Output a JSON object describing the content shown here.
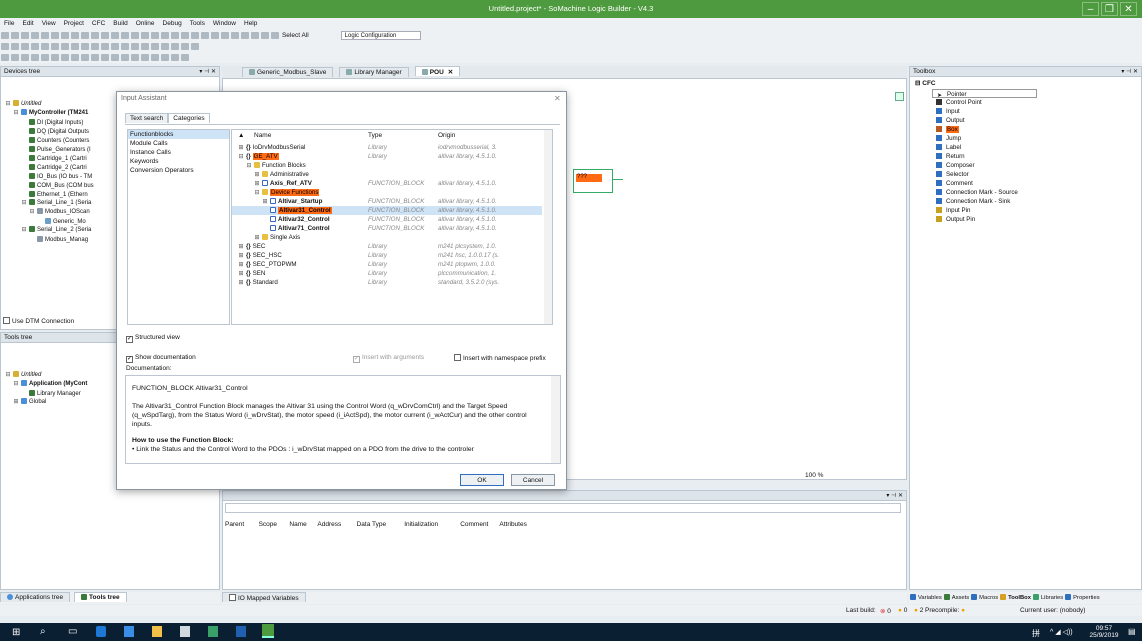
{
  "window": {
    "title": "Untitled.project* - SoMachine Logic Builder - V4.3"
  },
  "menu": [
    "File",
    "Edit",
    "View",
    "Project",
    "CFC",
    "Build",
    "Online",
    "Debug",
    "Tools",
    "Window",
    "Help"
  ],
  "toolbar": {
    "select_all": "Select All",
    "logic_config": "Logic Configuration"
  },
  "devices": {
    "title": "Devices tree",
    "items": [
      {
        "label": "Untitled",
        "level": 0,
        "exp": "-",
        "italic": true
      },
      {
        "label": "MyController (TM241",
        "level": 1,
        "exp": "-",
        "bold": true
      },
      {
        "label": "DI (Digital Inputs)",
        "level": 2
      },
      {
        "label": "DQ (Digital Outputs",
        "level": 2
      },
      {
        "label": "Counters (Counters",
        "level": 2
      },
      {
        "label": "Pulse_Generators (I",
        "level": 2
      },
      {
        "label": "Cartridge_1 (Cartri",
        "level": 2
      },
      {
        "label": "Cartridge_2 (Cartri",
        "level": 2
      },
      {
        "label": "IO_Bus (IO bus - TM",
        "level": 2
      },
      {
        "label": "COM_Bus (COM bus",
        "level": 2
      },
      {
        "label": "Ethernet_1 (Ethern",
        "level": 2
      },
      {
        "label": "Serial_Line_1 (Seria",
        "level": 2,
        "exp": "-"
      },
      {
        "label": "Modbus_IOScan",
        "level": 3,
        "exp": "-"
      },
      {
        "label": "Generic_Mo",
        "level": 4
      },
      {
        "label": "Serial_Line_2 (Seria",
        "level": 2,
        "exp": "-"
      },
      {
        "label": "Modbus_Manag",
        "level": 3
      }
    ],
    "use_dtm": "Use DTM Connection"
  },
  "tools_tree": {
    "title": "Tools tree",
    "items": [
      {
        "label": "Untitled",
        "level": 0,
        "exp": "-",
        "italic": true
      },
      {
        "label": "Application (MyCont",
        "level": 1,
        "exp": "-",
        "bold": true
      },
      {
        "label": "Library Manager",
        "level": 2
      },
      {
        "label": "Global",
        "level": 1,
        "exp": "+"
      }
    ]
  },
  "bottom_tabs": {
    "applications": "Applications tree",
    "tools": "Tools tree",
    "io_mapped": "IO Mapped Variables"
  },
  "doc_tabs": [
    "Generic_Modbus_Slave",
    "Library Manager",
    "POU"
  ],
  "dialog": {
    "title": "Input Assistant",
    "tabs": [
      "Text search",
      "Categories"
    ],
    "categories": [
      "Functionblocks",
      "Module Calls",
      "Instance Calls",
      "Keywords",
      "Conversion Operators"
    ],
    "headers": {
      "name": "Name",
      "type": "Type",
      "origin": "Origin"
    },
    "rows": [
      {
        "indent": 0,
        "exp": "+",
        "icon": "{}",
        "name": "IoDrvModbusSerial",
        "type": "Library",
        "origin": "iodrvmodbusserial, 3.",
        "hl": false
      },
      {
        "indent": 0,
        "exp": "-",
        "icon": "{}",
        "name": "GE_ATV",
        "type": "Library",
        "origin": "altivar library, 4.5.1.0.",
        "hl": true
      },
      {
        "indent": 1,
        "exp": "-",
        "icon": "folder",
        "name": "Function Blocks",
        "type": "",
        "origin": "",
        "hl": false
      },
      {
        "indent": 2,
        "exp": "+",
        "icon": "folder",
        "name": "Administrative",
        "type": "",
        "origin": "",
        "hl": false
      },
      {
        "indent": 2,
        "exp": "+",
        "icon": "fb",
        "name": "Axis_Ref_ATV",
        "type": "FUNCTION_BLOCK",
        "origin": "altivar library, 4.5.1.0.",
        "hl": false,
        "bold": true
      },
      {
        "indent": 2,
        "exp": "-",
        "icon": "folder",
        "name": "Device Functions",
        "type": "",
        "origin": "",
        "hl": true
      },
      {
        "indent": 3,
        "exp": "+",
        "icon": "fb",
        "name": "Altivar_Startup",
        "type": "FUNCTION_BLOCK",
        "origin": "altivar library, 4.5.1.0.",
        "hl": false,
        "bold": true
      },
      {
        "indent": 3,
        "exp": "",
        "icon": "fb",
        "name": "Altivar31_Control",
        "type": "FUNCTION_BLOCK",
        "origin": "altivar library, 4.5.1.0.",
        "hl": true,
        "bold": true,
        "sel": true
      },
      {
        "indent": 3,
        "exp": "",
        "icon": "fb",
        "name": "Altivar32_Control",
        "type": "FUNCTION_BLOCK",
        "origin": "altivar library, 4.5.1.0.",
        "hl": false,
        "bold": true
      },
      {
        "indent": 3,
        "exp": "",
        "icon": "fb",
        "name": "Altivar71_Control",
        "type": "FUNCTION_BLOCK",
        "origin": "altivar library, 4.5.1.0.",
        "hl": false,
        "bold": true
      },
      {
        "indent": 2,
        "exp": "+",
        "icon": "folder",
        "name": "Single Axis",
        "type": "",
        "origin": "",
        "hl": false
      },
      {
        "indent": 0,
        "exp": "+",
        "icon": "{}",
        "name": "SEC",
        "type": "Library",
        "origin": "m241 plcsystem, 1.0.",
        "hl": false
      },
      {
        "indent": 0,
        "exp": "+",
        "icon": "{}",
        "name": "SEC_HSC",
        "type": "Library",
        "origin": "m241 hsc, 1.0.0.17 (s.",
        "hl": false
      },
      {
        "indent": 0,
        "exp": "+",
        "icon": "{}",
        "name": "SEC_PTOPWM",
        "type": "Library",
        "origin": "m241 ptopwm, 1.0.0.",
        "hl": false
      },
      {
        "indent": 0,
        "exp": "+",
        "icon": "{}",
        "name": "SEN",
        "type": "Library",
        "origin": "plccommunication, 1.",
        "hl": false
      },
      {
        "indent": 0,
        "exp": "+",
        "icon": "{}",
        "name": "Standard",
        "type": "Library",
        "origin": "standard, 3.5.2.0 (sys.",
        "hl": false
      }
    ],
    "structured_view": "Structured view",
    "show_doc": "Show documentation",
    "insert_args": "Insert with arguments",
    "insert_ns": "Insert with namespace prefix",
    "doc_label": "Documentation:",
    "doc_title": "FUNCTION_BLOCK Altivar31_Control",
    "doc_body": "The Altivar31_Control Function Block manages the Altivar 31 using the Control Word (q_wDrvComCtrl) and the Target Speed (q_wSpdTarg), from the Status Word (i_wDrvStat), the motor speed (i_iActSpd), the motor current (i_wActCur) and the other control inputs.",
    "doc_howto": "How to use the Function Block:",
    "doc_bullet": "• Link the Status and the Control Word to the PDOs : i_wDrvStat mapped on a PDO from the drive to the controler",
    "ok": "OK",
    "cancel": "Cancel"
  },
  "editor": {
    "block_label": "???",
    "zoom": "100 %"
  },
  "vars": {
    "headers": [
      "Parent",
      "Scope",
      "Name",
      "Address",
      "Data Type",
      "Initialization",
      "Comment",
      "Attributes"
    ]
  },
  "toolbox": {
    "title": "Toolbox",
    "section": "CFC",
    "items": [
      "Pointer",
      "Control Point",
      "Input",
      "Output",
      "Box",
      "Jump",
      "Label",
      "Return",
      "Composer",
      "Selector",
      "Comment",
      "Connection Mark - Source",
      "Connection Mark - Sink",
      "Input Pin",
      "Output Pin"
    ],
    "highlighted": "Box"
  },
  "right_tabs": [
    "Variables",
    "Assets",
    "Macros",
    "ToolBox",
    "Libraries",
    "Properties"
  ],
  "status": {
    "last_build": "Last build:",
    "errors": "0",
    "warnings": "0",
    "messages": "2",
    "precompile": "Precompile:",
    "user": "Current user: (nobody)"
  },
  "taskbar": {
    "time": "09:57",
    "date": "25/9/2019",
    "lang": "拼"
  },
  "colors": {
    "title_green": "#4e9a3e",
    "highlight": "#ff6a13",
    "taskbar": "#0b1f33"
  }
}
